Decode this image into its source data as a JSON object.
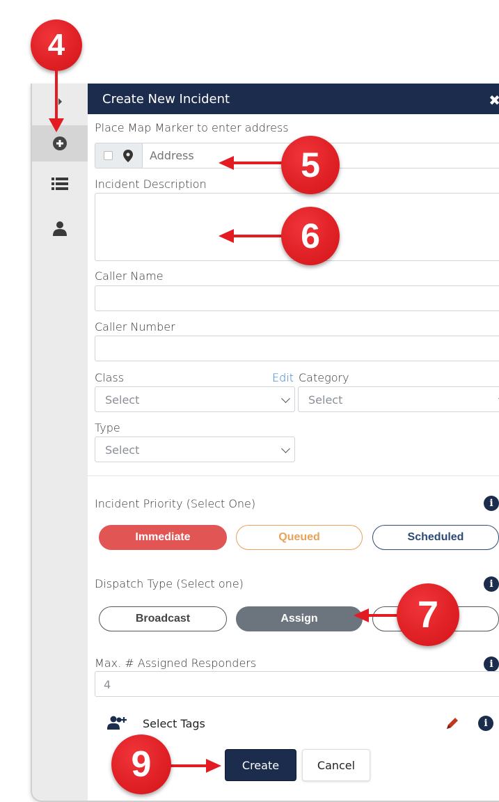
{
  "panel": {
    "title": "Create New Incident"
  },
  "address": {
    "label": "Place Map Marker to enter address",
    "placeholder": "Address"
  },
  "description": {
    "label": "Incident Description"
  },
  "caller_name": {
    "label": "Caller Name"
  },
  "caller_number": {
    "label": "Caller Number"
  },
  "class": {
    "label": "Class",
    "edit_link": "Edit",
    "selected": "Select"
  },
  "category": {
    "label": "Category",
    "selected": "Select"
  },
  "type": {
    "label": "Type",
    "selected": "Select"
  },
  "priority": {
    "label": "Incident Priority (Select One)",
    "options": [
      "Immediate",
      "Queued",
      "Scheduled"
    ]
  },
  "dispatch": {
    "label": "Dispatch Type (Select one)",
    "options": [
      "Broadcast",
      "Assign",
      ""
    ]
  },
  "max_responders": {
    "label": "Max. # Assigned Responders",
    "value": "4"
  },
  "tags": {
    "label": "Select Tags"
  },
  "actions": {
    "create": "Create",
    "cancel": "Cancel"
  },
  "annotations": [
    "4",
    "5",
    "6",
    "7",
    "9"
  ],
  "colors": {
    "header": "#1b2c4d",
    "immediate": "#e25555",
    "queued": "#e8a25a",
    "scheduled": "#2c4a78",
    "assign_active": "#6c757d",
    "callout": "#e31b23"
  },
  "icons": {
    "sidebar": [
      "chevron-right-icon",
      "plus-circle-icon",
      "list-icon",
      "user-icon"
    ],
    "tags": "user-plus-icon",
    "edit": "pencil-icon",
    "info": "info-icon",
    "map": "map-marker-icon"
  }
}
